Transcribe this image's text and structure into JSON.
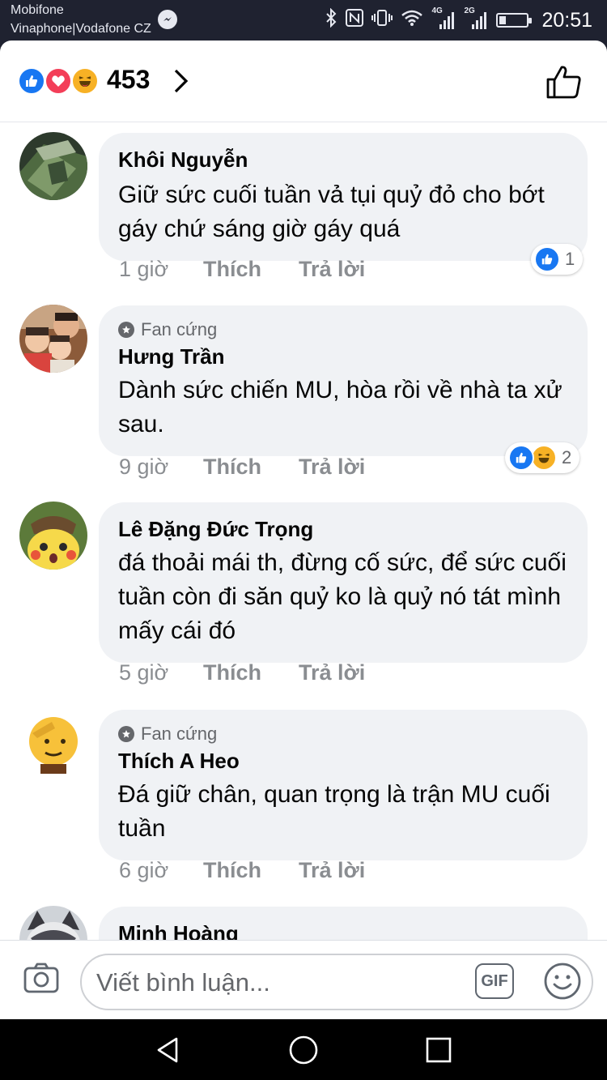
{
  "status_bar": {
    "carrier_line1": "Mobifone",
    "carrier_line2": "Vinaphone|Vodafone CZ",
    "network_1": "4G",
    "network_2": "2G",
    "time": "20:51"
  },
  "reactions": {
    "icons": [
      "like-icon",
      "love-icon",
      "haha-icon"
    ],
    "count": "453"
  },
  "comments": [
    {
      "author": "Khôi Nguyễn",
      "badge": "",
      "text": "Giữ sức cuối tuần vả tụi quỷ đỏ cho bớt gáy chứ sáng giờ gáy quá",
      "time": "1 giờ",
      "like_label": "Thích",
      "reply_label": "Trả lời",
      "reaction_count": "1",
      "reaction_icons": [
        "like-icon"
      ]
    },
    {
      "author": "Hưng Trần",
      "badge": "Fan cứng",
      "text": "Dành sức chiến MU, hòa rồi về nhà ta xử sau.",
      "time": "9 giờ",
      "like_label": "Thích",
      "reply_label": "Trả lời",
      "reaction_count": "2",
      "reaction_icons": [
        "like-icon",
        "haha-icon"
      ]
    },
    {
      "author": "Lê Đặng Đức Trọng",
      "badge": "",
      "text": "đá thoải mái th, đừng cố sức, để sức cuối tuần còn đi săn quỷ ko là quỷ nó tát mình mấy cái đó",
      "time": "5 giờ",
      "like_label": "Thích",
      "reply_label": "Trả lời"
    },
    {
      "author": "Thích A Heo",
      "badge": "Fan cứng",
      "text": "Đá giữ chân, quan trọng là trận MU cuối tuần",
      "time": "6 giờ",
      "like_label": "Thích",
      "reply_label": "Trả lời"
    },
    {
      "author": "Minh Hoàng",
      "badge": "",
      "text": ""
    }
  ],
  "composer": {
    "placeholder": "Viết bình luận...",
    "gif_label": "GIF"
  },
  "colors": {
    "like_blue": "#1877f2",
    "love_red": "#f33e58",
    "haha_yellow": "#f7b125",
    "bubble_gray": "#f0f2f5",
    "meta_gray": "#8a8d91"
  }
}
